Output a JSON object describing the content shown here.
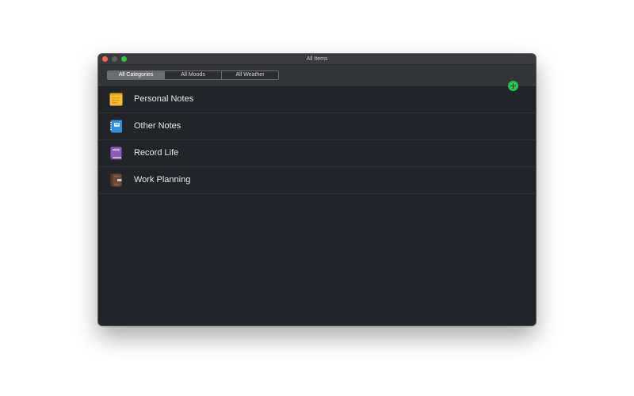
{
  "window": {
    "title": "All Items"
  },
  "toolbar": {
    "segments": [
      {
        "label": "All Categories",
        "active": true
      },
      {
        "label": "All Moods",
        "active": false
      },
      {
        "label": "All Weather",
        "active": false
      }
    ],
    "add_icon": "plus-circle-icon"
  },
  "list": {
    "items": [
      {
        "label": "Personal Notes",
        "icon": "sticky-note-icon",
        "color": "#f5c02a"
      },
      {
        "label": "Other Notes",
        "icon": "spiral-notebook-icon",
        "color": "#2f8fe0"
      },
      {
        "label": "Record Life",
        "icon": "journal-book-icon",
        "color": "#8a5cc2"
      },
      {
        "label": "Work Planning",
        "icon": "planner-book-icon",
        "color": "#6b4a3c"
      }
    ]
  },
  "colors": {
    "window_bg": "#212429",
    "toolbar_bg": "#323438",
    "accent_green": "#27c44a",
    "text": "#e8e8ea"
  }
}
